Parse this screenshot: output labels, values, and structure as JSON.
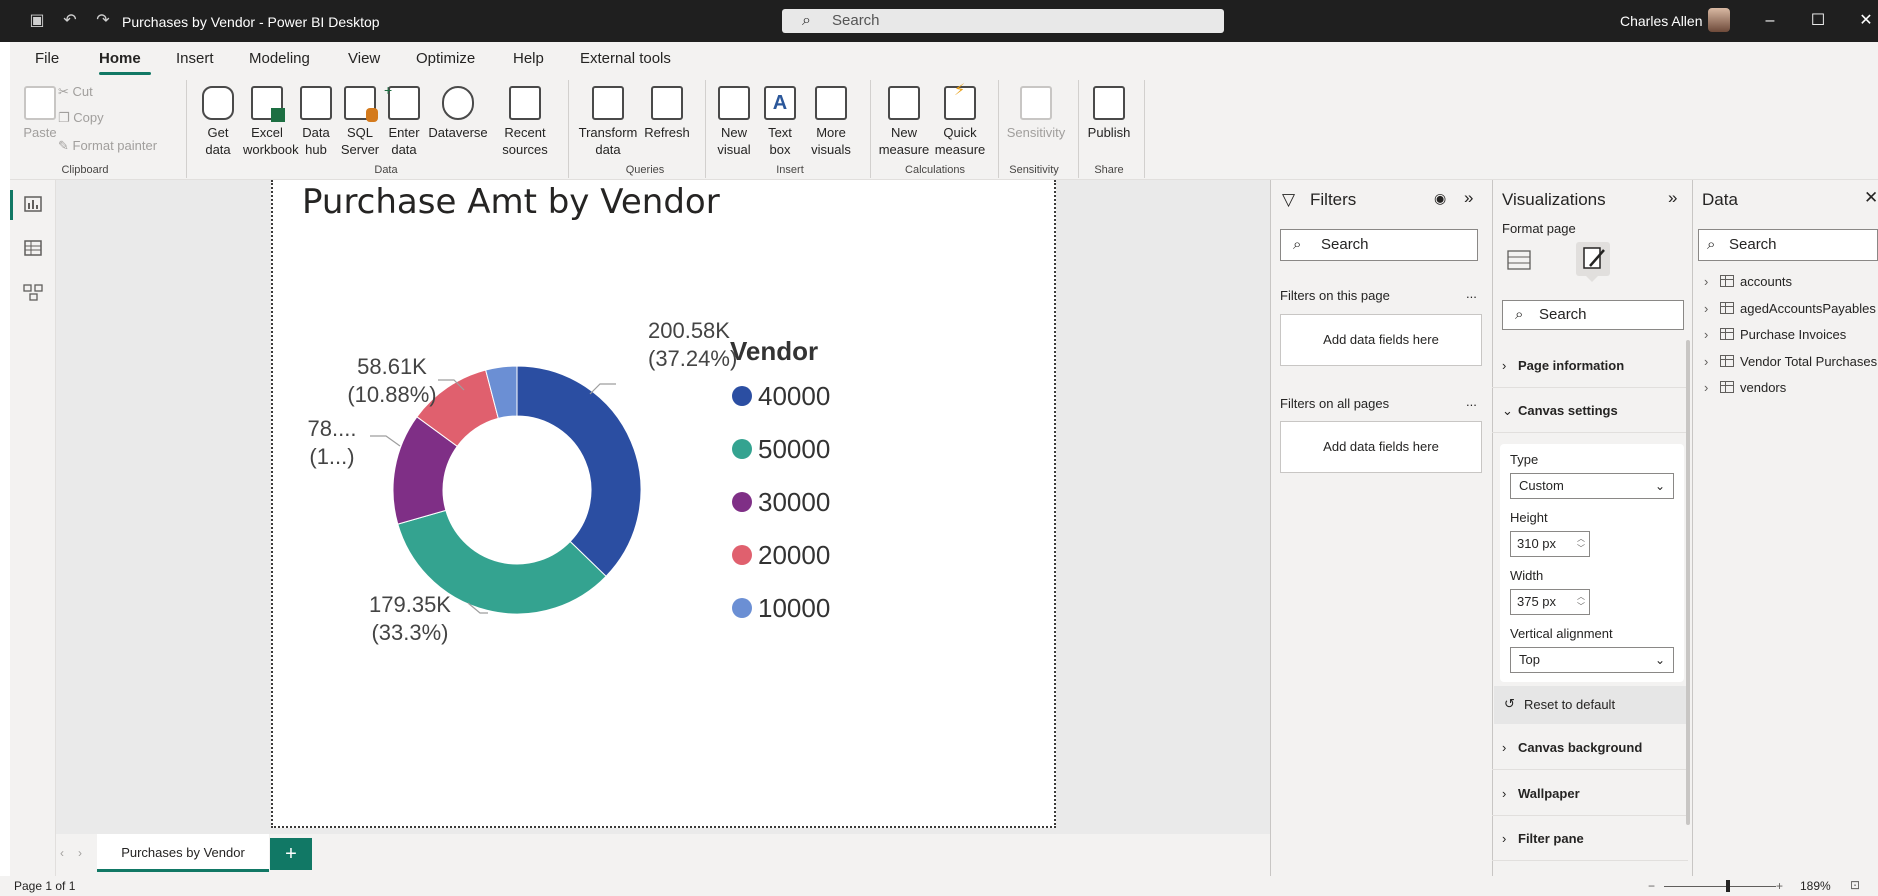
{
  "window": {
    "title": "Purchases by Vendor - Power BI Desktop",
    "search_placeholder": "Search",
    "user_name": "Charles Allen"
  },
  "menu": {
    "tabs": [
      "File",
      "Home",
      "Insert",
      "Modeling",
      "View",
      "Optimize",
      "Help",
      "External tools"
    ],
    "active": "Home"
  },
  "ribbon": {
    "clipboard": {
      "paste": "Paste",
      "cut": "Cut",
      "copy": "Copy",
      "format_painter": "Format painter",
      "group": "Clipboard"
    },
    "data": {
      "get_data": "Get data",
      "excel": "Excel workbook",
      "data_hub": "Data hub",
      "sql": "SQL Server",
      "enter_data": "Enter data",
      "dataverse": "Dataverse",
      "recent": "Recent sources",
      "group": "Data"
    },
    "queries": {
      "transform": "Transform data",
      "refresh": "Refresh",
      "group": "Queries"
    },
    "insert": {
      "new_visual": "New visual",
      "text_box": "Text box",
      "more_visuals": "More visuals",
      "group": "Insert"
    },
    "calculations": {
      "new_measure": "New measure",
      "quick_measure": "Quick measure",
      "group": "Calculations"
    },
    "sensitivity": {
      "label": "Sensitivity",
      "group": "Sensitivity"
    },
    "share": {
      "publish": "Publish",
      "group": "Share"
    }
  },
  "report": {
    "page_tab": "Purchases by Vendor",
    "add_tab": "+",
    "status": "Page 1 of 1",
    "zoom": "189%"
  },
  "filters": {
    "title": "Filters",
    "search": "Search",
    "on_this_page": "Filters on this page",
    "on_all_pages": "Filters on all pages",
    "drop_here": "Add data fields here",
    "more": "..."
  },
  "visualizations": {
    "title": "Visualizations",
    "format_page": "Format page",
    "search": "Search",
    "sections": [
      "Page information",
      "Canvas settings",
      "Canvas background",
      "Wallpaper",
      "Filter pane"
    ],
    "canvas_settings": {
      "type_label": "Type",
      "type_value": "Custom",
      "height_label": "Height",
      "height_value": "310 px",
      "width_label": "Width",
      "width_value": "375 px",
      "valign_label": "Vertical alignment",
      "valign_value": "Top"
    },
    "reset": "Reset to default"
  },
  "data_pane": {
    "title": "Data",
    "search": "Search",
    "tables": [
      "accounts",
      "agedAccountsPayables",
      "Purchase Invoices",
      "Vendor Total Purchases",
      "vendors"
    ]
  },
  "chart_data": {
    "type": "pie",
    "title": "Purchase Amt by Vendor",
    "legend_title": "Vendor",
    "legend_position": "right",
    "categories": [
      "40000",
      "50000",
      "30000",
      "20000",
      "10000"
    ],
    "values": [
      200.58,
      179.35,
      78,
      58.61,
      21.9
    ],
    "unit": "K",
    "data_labels": [
      {
        "value": "200.58K",
        "pct": "(37.24%)"
      },
      {
        "value": "179.35K",
        "pct": "(33.3%)"
      },
      {
        "value": "78....",
        "pct": "(1...)"
      },
      {
        "value": "58.61K",
        "pct": "(10.88%)"
      }
    ],
    "colors": [
      "#2b4ea2",
      "#34a390",
      "#7f2f86",
      "#e0606e",
      "#6b8fd4"
    ],
    "donut": true
  }
}
